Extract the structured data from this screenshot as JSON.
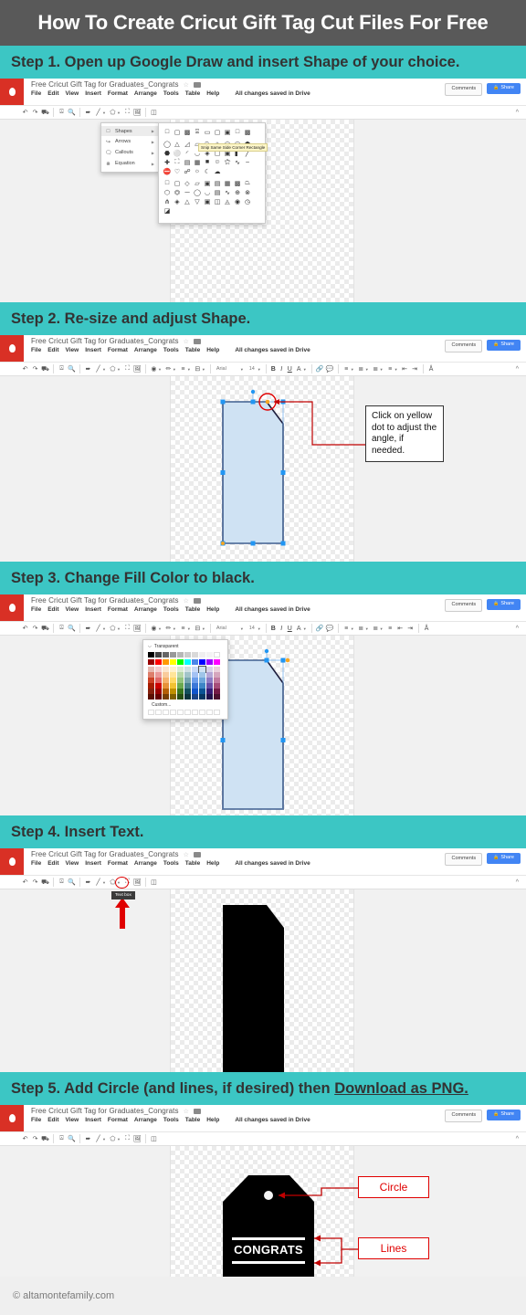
{
  "header": {
    "title": "How To Create Cricut Gift Tag Cut Files For Free"
  },
  "colors": {
    "header_bg": "#595959",
    "banner_bg": "#3cc6c4",
    "banner_text": "#333333",
    "accent_red": "#c00000",
    "label_red": "#e00000",
    "share_blue": "#4285f4",
    "logo_red": "#d93025",
    "shape_fill": "#cfe2f3",
    "shape_stroke": "#1c1c3c",
    "handle_blue": "#2196f3",
    "handle_yellow": "#f5a623",
    "footer_text": "#7a7a7a"
  },
  "steps": [
    {
      "id": "step1",
      "text": "Step 1. Open up Google Draw and insert Shape of your choice.",
      "underline": ""
    },
    {
      "id": "step2",
      "text": "Step 2.  Re-size and adjust Shape.",
      "underline": ""
    },
    {
      "id": "step3",
      "text": "Step 3.  Change Fill Color to black.",
      "underline": ""
    },
    {
      "id": "step4",
      "text": "Step 4.  Insert Text.",
      "underline": ""
    },
    {
      "id": "step5",
      "text": "Step 5.  Add Circle (and lines, if desired) then ",
      "underline": "Download as PNG."
    }
  ],
  "google_drawings": {
    "doc_name": "Free Cricut Gift Tag for Graduates_Congrats",
    "menus": [
      "File",
      "Edit",
      "View",
      "Insert",
      "Format",
      "Arrange",
      "Tools",
      "Table",
      "Help"
    ],
    "save_status": "All changes saved in Drive",
    "comments_label": "Comments",
    "share_label": "Share",
    "font_name": "Arial",
    "font_size": "14"
  },
  "step1": {
    "shapes_menu": [
      {
        "label": "Shapes",
        "icon": "square-icon",
        "selected": true
      },
      {
        "label": "Arrows",
        "icon": "arrow-icon",
        "selected": false
      },
      {
        "label": "Callouts",
        "icon": "callout-icon",
        "selected": false
      },
      {
        "label": "Equation",
        "icon": "equation-icon",
        "selected": false
      }
    ],
    "tooltip": "Snip Same Side Corner Rectangle"
  },
  "step2": {
    "callout_text": "Click on yellow dot to adjust the angle, if needed."
  },
  "step3": {
    "color_picker": {
      "transparent_label": "Transparent",
      "custom_label": "Custom...",
      "row_gray": [
        "#000000",
        "#434343",
        "#666666",
        "#999999",
        "#b7b7b7",
        "#cccccc",
        "#d9d9d9",
        "#efefef",
        "#f3f3f3",
        "#ffffff"
      ],
      "row_bright": [
        "#980000",
        "#ff0000",
        "#ff9900",
        "#ffff00",
        "#00ff00",
        "#00ffff",
        "#4a86e8",
        "#0000ff",
        "#9900ff",
        "#ff00ff"
      ],
      "row_t1": [
        "#e6b8af",
        "#f4cccc",
        "#fce5cd",
        "#fff2cc",
        "#d9ead3",
        "#d0e0e3",
        "#c9daf8",
        "#cfe2f3",
        "#d9d2e9",
        "#ead1dc"
      ],
      "row_t2": [
        "#dd7e6b",
        "#ea9999",
        "#f9cb9c",
        "#ffe599",
        "#b6d7a8",
        "#a2c4c9",
        "#a4c2f4",
        "#9fc5e8",
        "#b4a7d6",
        "#d5a6bd"
      ],
      "row_t3": [
        "#cc4125",
        "#e06666",
        "#f6b26b",
        "#ffd966",
        "#93c47d",
        "#76a5af",
        "#6d9eeb",
        "#6fa8dc",
        "#8e7cc3",
        "#c27ba0"
      ],
      "row_t4": [
        "#a61c00",
        "#cc0000",
        "#e69138",
        "#f1c232",
        "#6aa84f",
        "#45818e",
        "#3c78d8",
        "#3d85c6",
        "#674ea7",
        "#a64d79"
      ],
      "row_t5": [
        "#85200c",
        "#990000",
        "#b45f06",
        "#bf9000",
        "#38761d",
        "#134f5c",
        "#1155cc",
        "#0b5394",
        "#351c75",
        "#741b47"
      ],
      "row_t6": [
        "#5b0f00",
        "#660000",
        "#783f04",
        "#7f6000",
        "#274e13",
        "#0c343d",
        "#1c4587",
        "#073763",
        "#20124d",
        "#4c1130"
      ]
    }
  },
  "step4": {
    "tooltip": "Text box"
  },
  "step5": {
    "tag_text": "CONGRATS",
    "labels": [
      {
        "text": "Circle"
      },
      {
        "text": "Lines"
      }
    ]
  },
  "footer": {
    "copyright": "© altamontefamily.com"
  }
}
